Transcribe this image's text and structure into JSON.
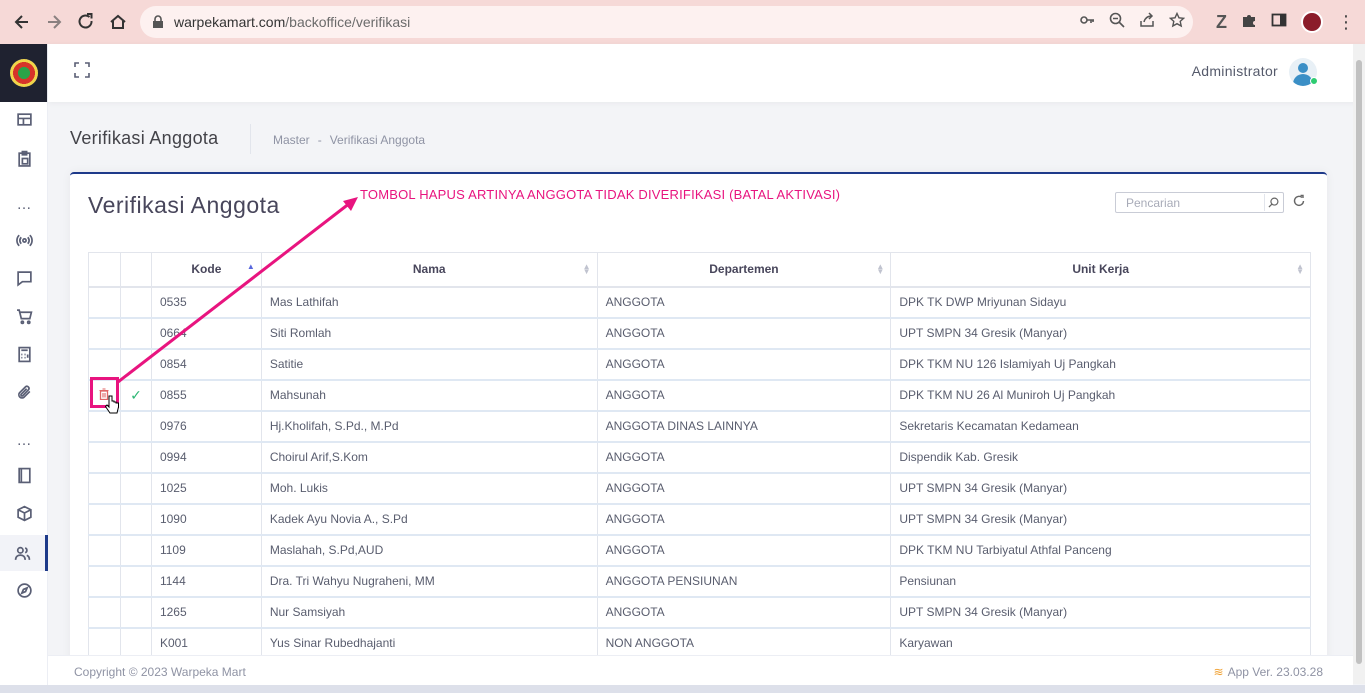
{
  "browser": {
    "url_domain": "warpekamart.com",
    "url_path": "/backoffice/verifikasi"
  },
  "header": {
    "user_name": "Administrator"
  },
  "subheader": {
    "title": "Verifikasi Anggota",
    "breadcrumb": [
      "Master",
      "-",
      "Verifikasi Anggota"
    ]
  },
  "card": {
    "title": "Verifikasi Anggota",
    "search_placeholder": "Pencarian"
  },
  "table": {
    "columns": [
      "Kode",
      "Nama",
      "Departemen",
      "Unit Kerja"
    ],
    "rows": [
      {
        "kode": "0535",
        "nama": "Mas Lathifah",
        "departemen": "ANGGOTA",
        "unit": "DPK TK DWP Mriyunan Sidayu"
      },
      {
        "kode": "0664",
        "nama": "Siti Romlah",
        "departemen": "ANGGOTA",
        "unit": "UPT SMPN 34 Gresik (Manyar)"
      },
      {
        "kode": "0854",
        "nama": "Satitie",
        "departemen": "ANGGOTA",
        "unit": "DPK TKM NU 126 Islamiyah Uj Pangkah"
      },
      {
        "kode": "0855",
        "nama": "Mahsunah",
        "departemen": "ANGGOTA",
        "unit": "DPK TKM NU 26 Al Muniroh Uj Pangkah"
      },
      {
        "kode": "0976",
        "nama": "Hj.Kholifah, S.Pd., M.Pd",
        "departemen": "ANGGOTA DINAS LAINNYA",
        "unit": "Sekretaris Kecamatan Kedamean"
      },
      {
        "kode": "0994",
        "nama": "Choirul Arif,S.Kom",
        "departemen": "ANGGOTA",
        "unit": "Dispendik Kab. Gresik"
      },
      {
        "kode": "1025",
        "nama": "Moh. Lukis",
        "departemen": "ANGGOTA",
        "unit": "UPT SMPN 34 Gresik (Manyar)"
      },
      {
        "kode": "1090",
        "nama": "Kadek Ayu Novia A., S.Pd",
        "departemen": "ANGGOTA",
        "unit": "UPT SMPN 34 Gresik (Manyar)"
      },
      {
        "kode": "1109",
        "nama": "Maslahah, S.Pd,AUD",
        "departemen": "ANGGOTA",
        "unit": "DPK TKM NU Tarbiyatul Athfal Panceng"
      },
      {
        "kode": "1144",
        "nama": "Dra. Tri Wahyu Nugraheni, MM",
        "departemen": "ANGGOTA PENSIUNAN",
        "unit": "Pensiunan"
      },
      {
        "kode": "1265",
        "nama": "Nur Samsiyah",
        "departemen": "ANGGOTA",
        "unit": "UPT SMPN 34 Gresik (Manyar)"
      },
      {
        "kode": "K001",
        "nama": "Yus Sinar Rubedhajanti",
        "departemen": "NON ANGGOTA",
        "unit": "Karyawan"
      }
    ]
  },
  "annotation": {
    "text": "TOMBOL HAPUS ARTINYA ANGGOTA TIDAK DIVERIFIKASI (BATAL AKTIVASI)",
    "color": "#e8147f"
  },
  "footer": {
    "copyright": "Copyright © 2023 Warpeka Mart",
    "version": "App Ver. 23.03.28"
  },
  "colors": {
    "accent": "#1e3a8a",
    "check": "#2bb673",
    "delete": "#e06666"
  },
  "icons": [
    "back-icon",
    "forward-icon",
    "reload-icon",
    "home-icon",
    "key-icon",
    "zoom-icon",
    "share-icon",
    "star-icon",
    "extension-icon",
    "puzzle-icon",
    "sidepanel-icon",
    "menu-icon",
    "expand-icon",
    "dashboard-icon",
    "clipboard-icon",
    "broadcast-icon",
    "chat-icon",
    "cart-icon",
    "calculator-icon",
    "paperclip-icon",
    "book-icon",
    "box-icon",
    "users-icon",
    "compass-icon",
    "search-icon",
    "refresh-icon",
    "trash-icon",
    "check-icon"
  ]
}
